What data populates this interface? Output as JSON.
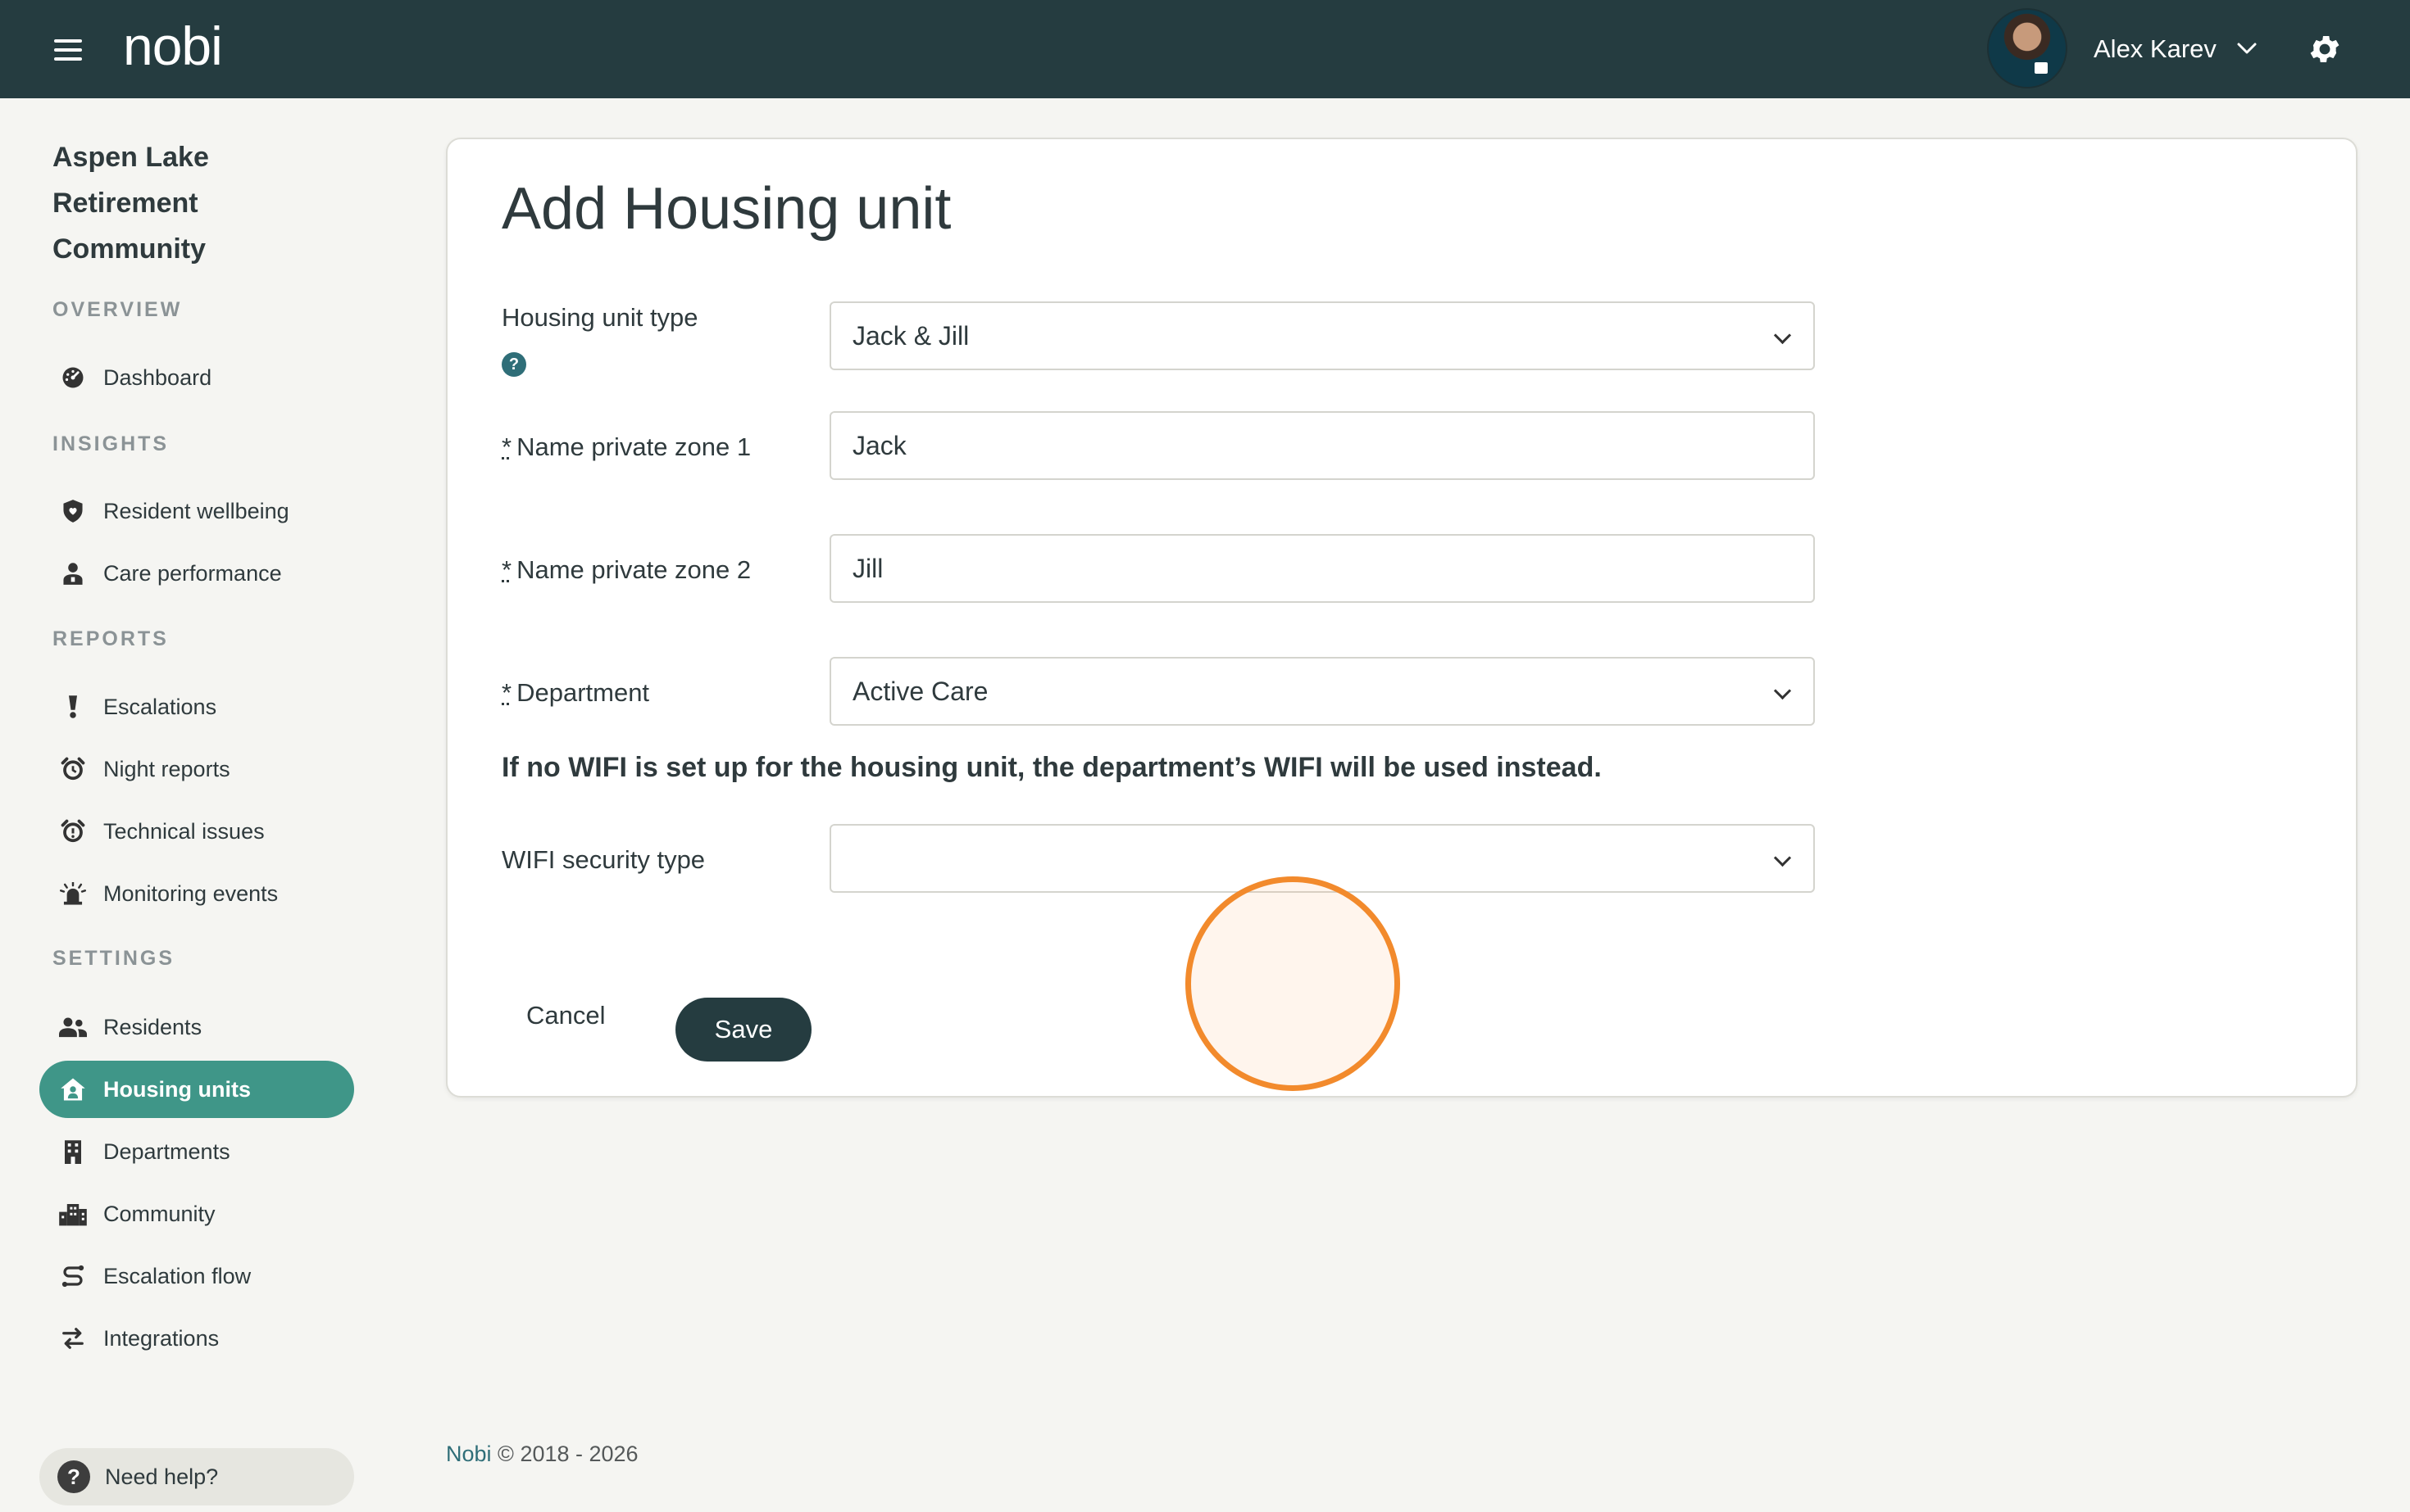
{
  "app": {
    "logo": "nobi"
  },
  "user": {
    "name": "Alex Karev"
  },
  "sidebar": {
    "community_name": "Aspen Lake Retirement Community",
    "sections": {
      "overview": "OVERVIEW",
      "insights": "INSIGHTS",
      "reports": "REPORTS",
      "settings": "SETTINGS"
    },
    "items": {
      "dashboard": "Dashboard",
      "resident_wellbeing": "Resident wellbeing",
      "care_performance": "Care performance",
      "escalations": "Escalations",
      "night_reports": "Night reports",
      "technical_issues": "Technical issues",
      "monitoring_events": "Monitoring events",
      "residents": "Residents",
      "housing_units": "Housing units",
      "departments": "Departments",
      "community": "Community",
      "escalation_flow": "Escalation flow",
      "integrations": "Integrations"
    },
    "active_item": "housing_units",
    "help": "Need help?"
  },
  "form": {
    "title": "Add Housing unit",
    "housing_unit_type": {
      "label": "Housing unit type",
      "value": "Jack & Jill"
    },
    "zone1": {
      "required_mark": "*",
      "label": "Name private zone 1",
      "value": "Jack"
    },
    "zone2": {
      "required_mark": "*",
      "label": "Name private zone 2",
      "value": "Jill"
    },
    "department": {
      "required_mark": "*",
      "label": "Department",
      "value": "Active Care"
    },
    "wifi_note": "If no WIFI is set up for the housing unit, the department’s WIFI will be used instead.",
    "wifi_security": {
      "label": "WIFI security type",
      "value": ""
    },
    "cancel_label": "Cancel",
    "save_label": "Save"
  },
  "footer": {
    "brand": "Nobi",
    "copyright": "© 2018 - 2026"
  },
  "colors": {
    "topbar": "#253c40",
    "active_nav": "#3f9688",
    "primary_button": "#253c40",
    "click_indicator": "#f28a2c"
  }
}
